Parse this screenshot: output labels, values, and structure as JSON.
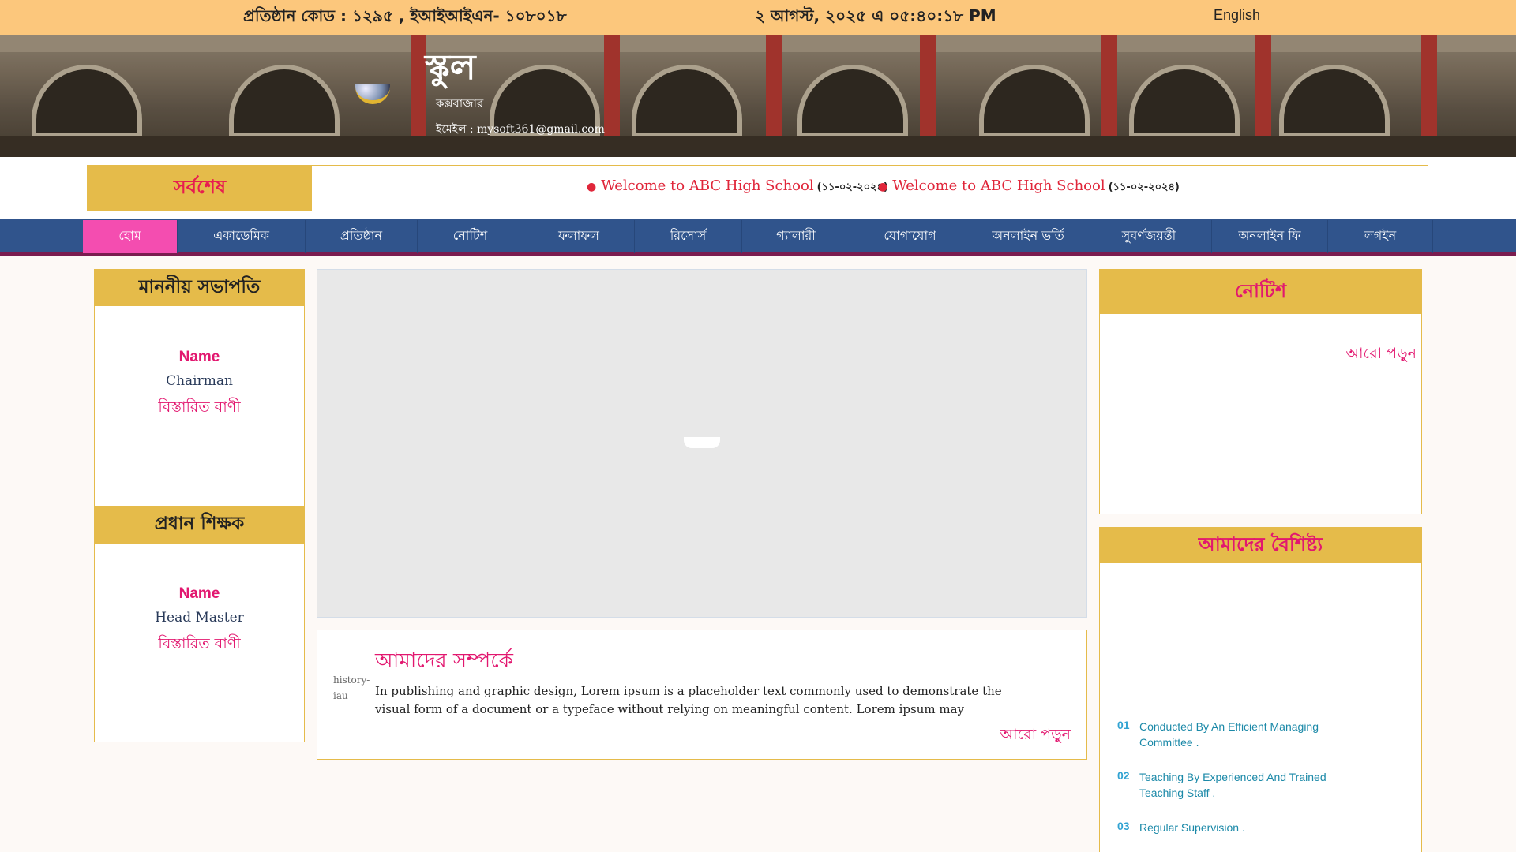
{
  "topbar": {
    "institution_code": "প্রতিষ্ঠান কোড : ১২৯৫ , ইআইআইএন- ১০৮০১৮",
    "datetime": "২ আগস্ট, ২০২৫ এ ০৫:৪০:১৮ PM",
    "language_toggle": "English"
  },
  "header": {
    "school_name": "স্কুল",
    "location": "কক্সবাজার",
    "email": "ইমেইল : mysoft361@gmail.com"
  },
  "ticker": {
    "label": "সর্বশেষ",
    "items": [
      {
        "text": "Welcome to ABC High School",
        "date": "(১১-০২-২০২৪)"
      },
      {
        "text": "Welcome to ABC High School",
        "date": "(১১-০২-২০২৪)"
      }
    ]
  },
  "nav": {
    "items": [
      {
        "label": "হোম"
      },
      {
        "label": "একাডেমিক"
      },
      {
        "label": "প্রতিষ্ঠান"
      },
      {
        "label": "নোটিশ"
      },
      {
        "label": "ফলাফল"
      },
      {
        "label": "রিসোর্স"
      },
      {
        "label": "গ্যালারী"
      },
      {
        "label": "যোগাযোগ"
      },
      {
        "label": "অনলাইন ভর্তি"
      },
      {
        "label": "সুবর্ণজয়ন্তী"
      },
      {
        "label": "অনলাইন ফি"
      },
      {
        "label": "লগইন"
      }
    ],
    "active_index": 0
  },
  "chairman": {
    "heading": "মাননীয় সভাপতি",
    "name": "Name",
    "role": "Chairman",
    "link": "বিস্তারিত বাণী"
  },
  "headmaster": {
    "heading": "প্রধান শিক্ষক",
    "name": "Name",
    "role": "Head Master",
    "link": "বিস্তারিত বাণী"
  },
  "about": {
    "image_alt": "history-iau",
    "title": "আমাদের সম্পর্কে",
    "text": "In publishing and graphic design, Lorem ipsum is a placeholder text commonly used to demonstrate the visual form of a document or a typeface without relying on meaningful content. Lorem ipsum may",
    "more": "আরো পড়ুন"
  },
  "notice": {
    "heading": "নোটিশ",
    "more": "আরো পড়ুন"
  },
  "features": {
    "heading": "আমাদের বৈশিষ্ট্য",
    "items": [
      {
        "num": "01",
        "text": "Conducted By An Efficient Managing Committee ."
      },
      {
        "num": "02",
        "text": "Teaching By Experienced And Trained Teaching Staff ."
      },
      {
        "num": "03",
        "text": "Regular Supervision ."
      }
    ]
  },
  "colors": {
    "topbar": "#fcc77c",
    "accent_gold": "#e5bb4a",
    "nav_blue": "#30548c",
    "nav_active": "#f44db0",
    "pink_text": "#e2176f"
  }
}
